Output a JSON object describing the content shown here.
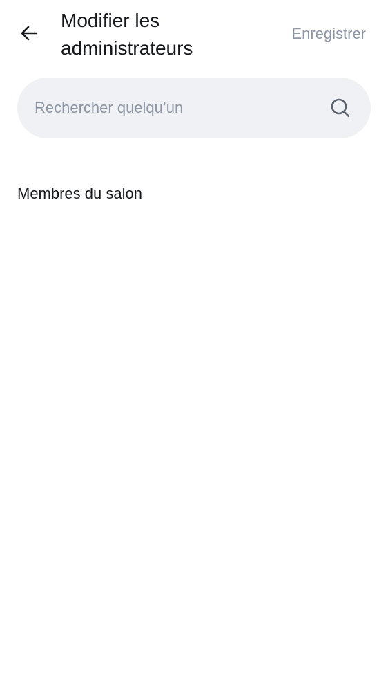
{
  "header": {
    "title": "Modifier les administrateurs",
    "save_label": "Enregistrer",
    "back_icon": "arrow-left-icon"
  },
  "search": {
    "placeholder": "Rechercher quelqu’un",
    "value": "",
    "icon": "search-icon"
  },
  "members": {
    "section_title": "Membres du salon",
    "items": []
  },
  "colors": {
    "text_primary": "#17191c",
    "text_secondary": "#8d97a5",
    "search_background": "#f0f1f4",
    "background": "#ffffff"
  }
}
